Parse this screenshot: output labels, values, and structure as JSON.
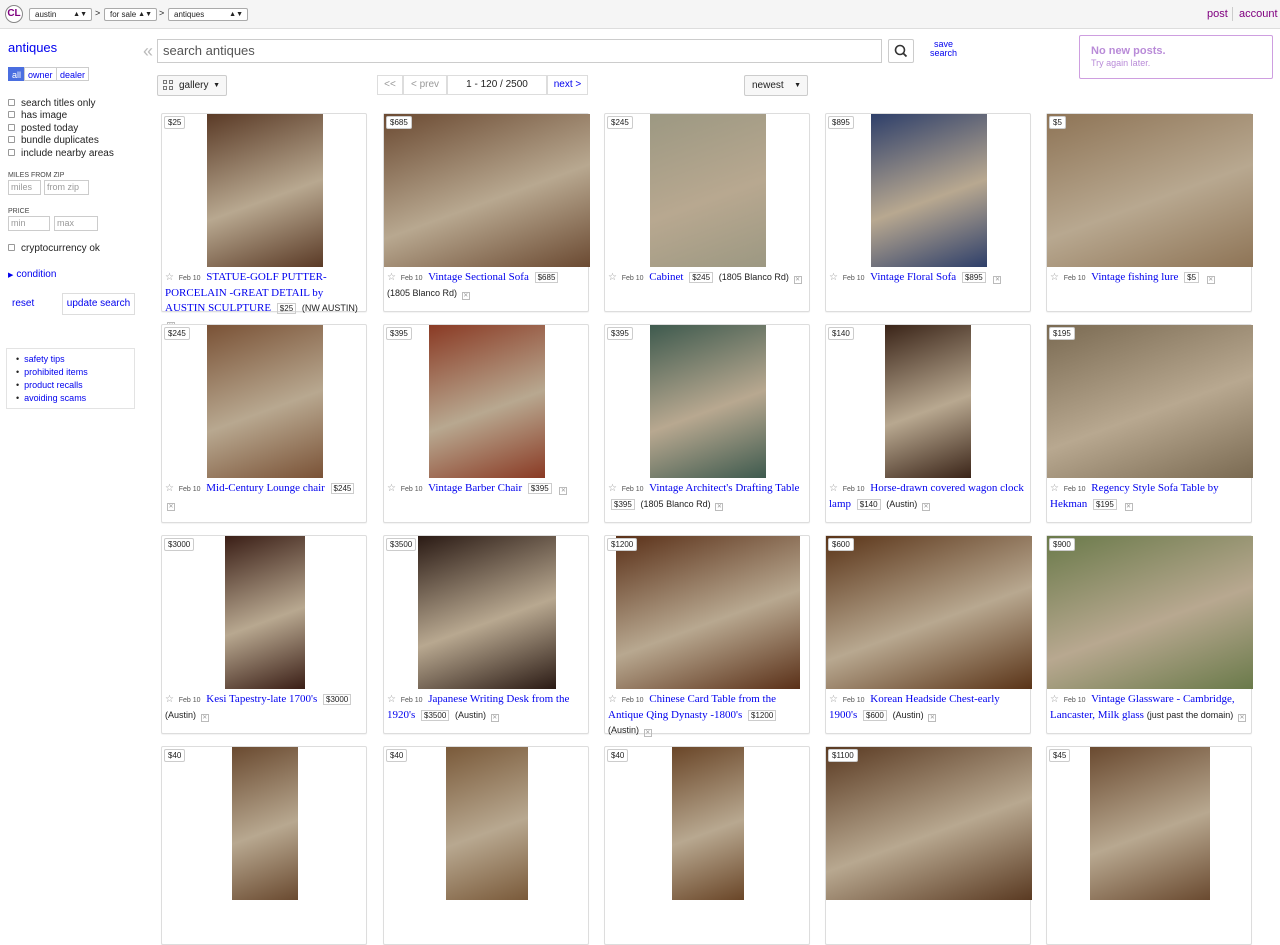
{
  "topbar": {
    "logo": "CL",
    "location": "austin",
    "section": "for sale",
    "category": "antiques",
    "post": "post",
    "account": "account"
  },
  "sidebar": {
    "title": "antiques",
    "segments": [
      "all",
      "owner",
      "dealer"
    ],
    "checkboxes": [
      "search titles only",
      "has image",
      "posted today",
      "bundle duplicates",
      "include nearby areas"
    ],
    "miles_from_zip_label": "MILES FROM ZIP",
    "miles_placeholder": "miles",
    "zip_placeholder": "from zip",
    "price_label": "PRICE",
    "min_placeholder": "min",
    "max_placeholder": "max",
    "crypto": "cryptocurrency ok",
    "condition": "condition",
    "reset": "reset",
    "update": "update search",
    "safety_links": [
      "safety tips",
      "prohibited items",
      "product recalls",
      "avoiding scams"
    ]
  },
  "search": {
    "placeholder": "search antiques",
    "save_line1": "save",
    "save_line2": "search"
  },
  "notice": {
    "title": "No new posts.",
    "subtitle": "Try again later."
  },
  "toolbar": {
    "view": "gallery",
    "first": "<<",
    "prev": "< prev",
    "range": "1 - 120 / 2500",
    "next": "next >",
    "sort": "newest"
  },
  "listings": [
    {
      "price": "$25",
      "date": "Feb 10",
      "title": "STATUE-GOLF PUTTER-PORCELAIN -GREAT DETAIL by AUSTIN SCULPTURE",
      "tag": "$25",
      "loc": "(NW AUSTIN)",
      "img": "#5a3a26"
    },
    {
      "price": "$685",
      "date": "Feb 10",
      "title": "Vintage Sectional Sofa",
      "tag": "$685",
      "loc": "(1805 Blanco Rd)",
      "img": "#6b4a32"
    },
    {
      "price": "$245",
      "date": "Feb 10",
      "title": "Cabinet",
      "tag": "$245",
      "loc": "(1805 Blanco Rd)",
      "img": "#9c9882"
    },
    {
      "price": "$895",
      "date": "Feb 10",
      "title": "Vintage Floral Sofa",
      "tag": "$895",
      "loc": "",
      "img": "#2e3f6a"
    },
    {
      "price": "$5",
      "date": "Feb 10",
      "title": "Vintage fishing lure",
      "tag": "$5",
      "loc": "",
      "img": "#8e7456"
    },
    {
      "price": "$245",
      "date": "Feb 10",
      "title": "Mid-Century Lounge chair",
      "tag": "$245",
      "loc": "",
      "img": "#7a5236"
    },
    {
      "price": "$395",
      "date": "Feb 10",
      "title": "Vintage Barber Chair",
      "tag": "$395",
      "loc": "",
      "img": "#8a3a24"
    },
    {
      "price": "$395",
      "date": "Feb 10",
      "title": "Vintage Architect's Drafting Table",
      "tag": "$395",
      "loc": "(1805 Blanco Rd)",
      "img": "#3e5a4e"
    },
    {
      "price": "$140",
      "date": "Feb 10",
      "title": "Horse-drawn covered wagon clock lamp",
      "tag": "$140",
      "loc": "(Austin)",
      "img": "#3a2418"
    },
    {
      "price": "$195",
      "date": "Feb 10",
      "title": "Regency Style Sofa Table by Hekman",
      "tag": "$195",
      "loc": "",
      "img": "#7a6a52"
    },
    {
      "price": "$3000",
      "date": "Feb 10",
      "title": "Kesi Tapestry-late 1700's",
      "tag": "$3000",
      "loc": "(Austin)",
      "img": "#3a1e16"
    },
    {
      "price": "$3500",
      "date": "Feb 10",
      "title": "Japanese Writing Desk from the 1920's",
      "tag": "$3500",
      "loc": "(Austin)",
      "img": "#2a1a14"
    },
    {
      "price": "$1200",
      "date": "Feb 10",
      "title": "Chinese Card Table from the Antique Qing Dynasty -1800's",
      "tag": "$1200",
      "loc": "(Austin)",
      "img": "#5a3018"
    },
    {
      "price": "$600",
      "date": "Feb 10",
      "title": "Korean Headside Chest-early 1900's",
      "tag": "$600",
      "loc": "(Austin)",
      "img": "#5a3418"
    },
    {
      "price": "$900",
      "date": "Feb 10",
      "title": "Vintage Glassware - Cambridge, Lancaster, Milk glass",
      "tag": "",
      "loc": "(just past the domain)",
      "img": "#6a7a4a"
    },
    {
      "price": "$40",
      "img": "#6a4a30"
    },
    {
      "price": "$40",
      "img": "#7a5a3a"
    },
    {
      "price": "$40",
      "img": "#6a4628"
    },
    {
      "price": "$1100",
      "img": "#5a3a22"
    },
    {
      "price": "$45",
      "img": "#6a4a30"
    }
  ]
}
